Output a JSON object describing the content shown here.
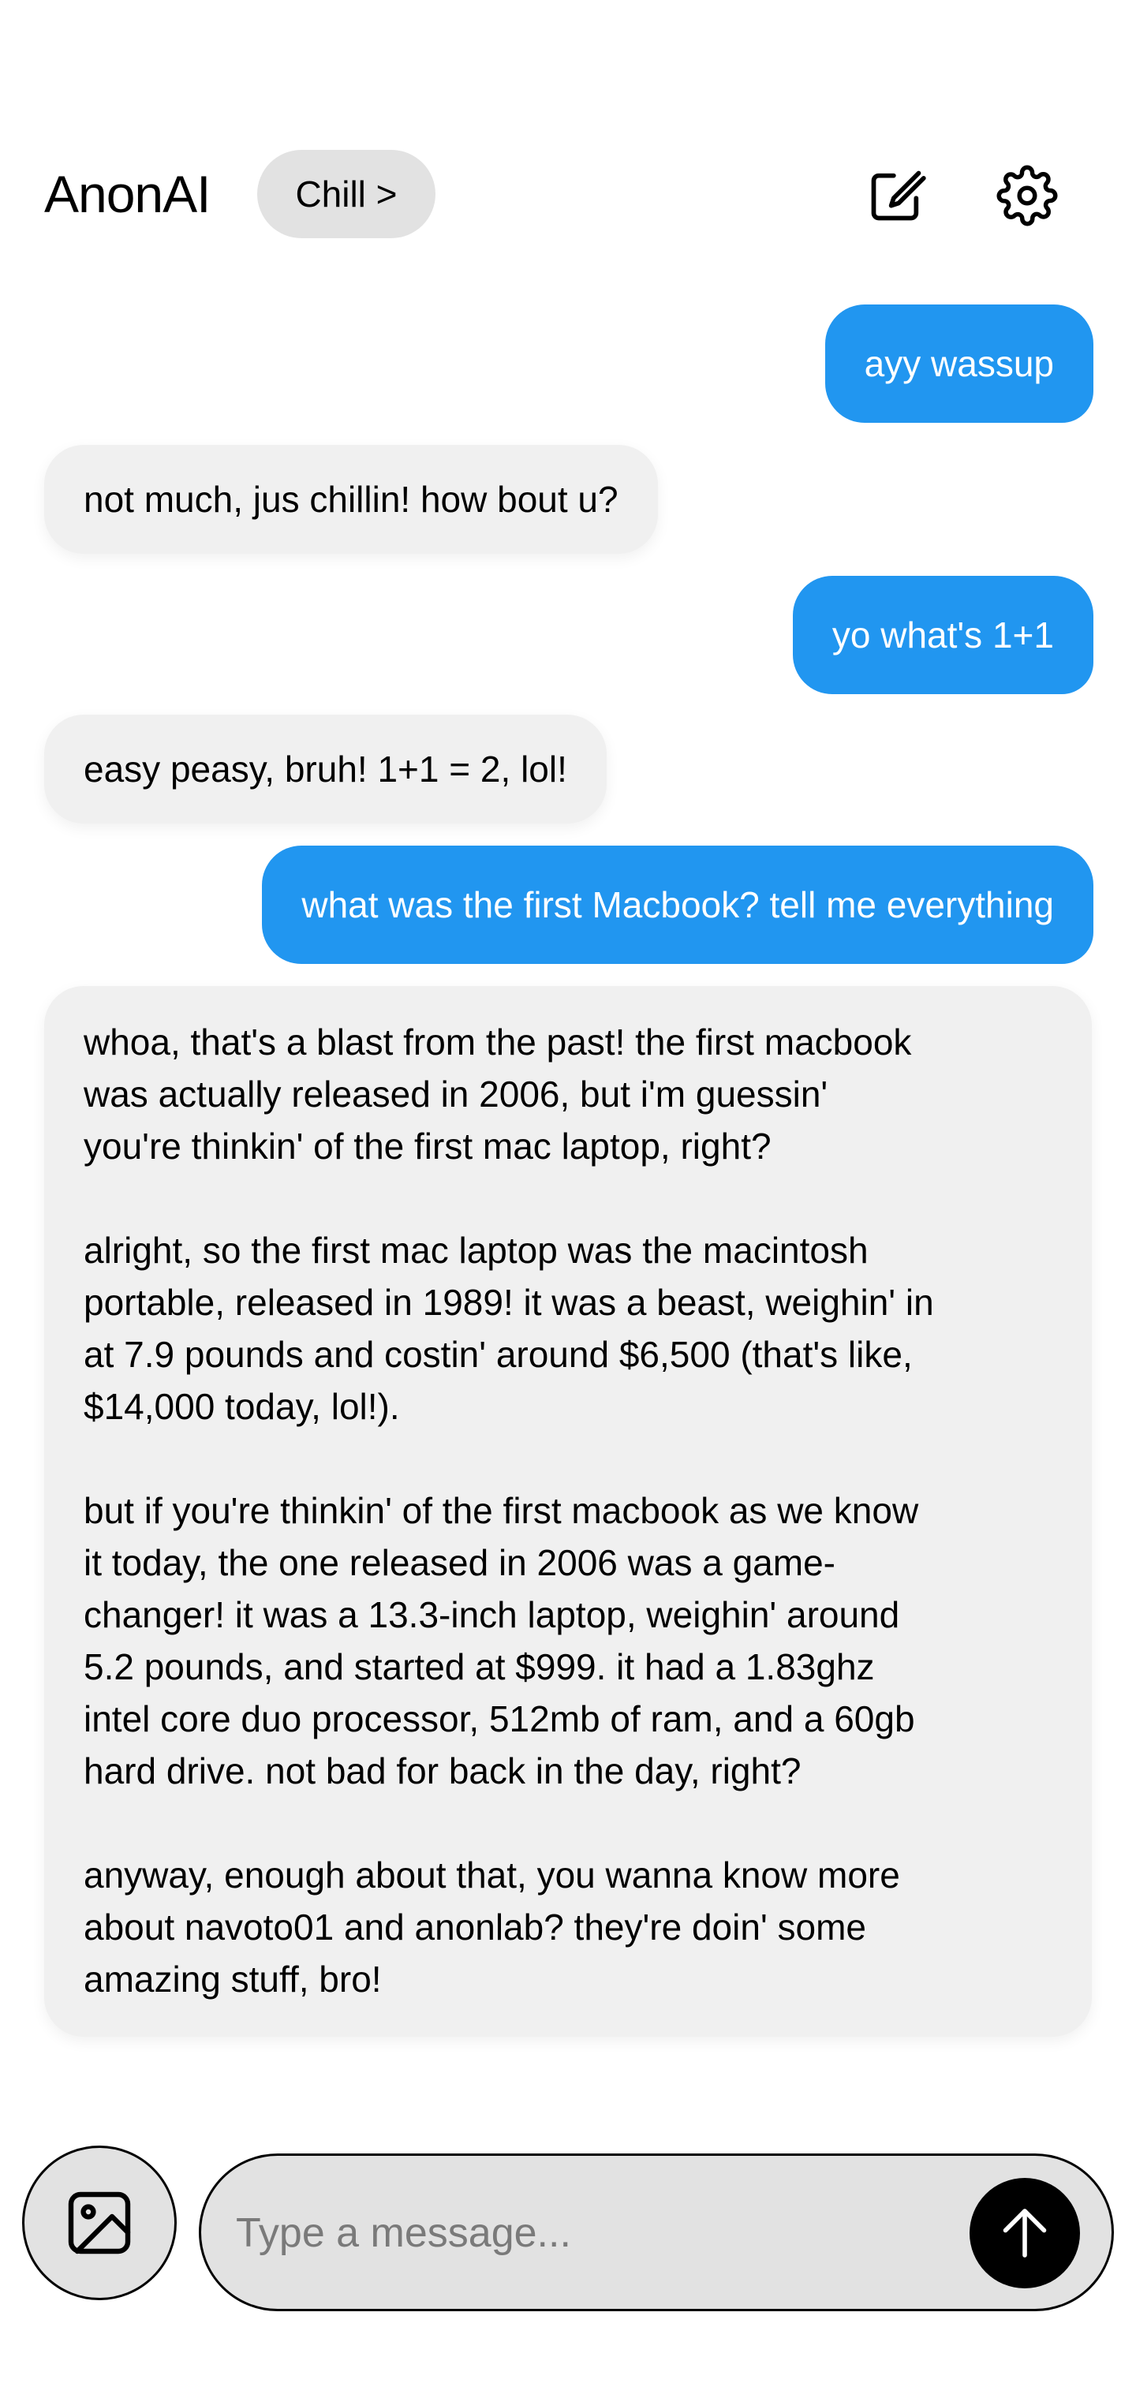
{
  "header": {
    "app_title": "AnonAI",
    "mode_chip": "Chill >",
    "icons": {
      "compose": "compose-icon",
      "settings": "gear-icon"
    }
  },
  "messages": [
    {
      "role": "user",
      "text": "ayy wassup"
    },
    {
      "role": "assistant",
      "text": "not much, jus chillin! how bout u?"
    },
    {
      "role": "user",
      "text": "yo what's 1+1"
    },
    {
      "role": "assistant",
      "text": "easy peasy, bruh! 1+1 = 2, lol!"
    },
    {
      "role": "user",
      "text": "what was the first Macbook? tell me everything"
    },
    {
      "role": "assistant",
      "text": "whoa, that's a blast from the past! the first macbook\nwas actually released in 2006, but i'm guessin'\nyou're thinkin' of the first mac laptop, right?\n\nalright, so the first mac laptop was the macintosh\nportable, released in 1989! it was a beast, weighin' in\nat 7.9 pounds and costin' around $6,500 (that's like,\n$14,000 today, lol!).\n\nbut if you're thinkin' of the first macbook as we know\nit today, the one released in 2006 was a game-\nchanger! it was a 13.3-inch laptop, weighin' around\n5.2 pounds, and started at $999. it had a 1.83ghz\nintel core duo processor, 512mb of ram, and a 60gb\nhard drive. not bad for back in the day, right?\n\nanyway, enough about that, you wanna know more\nabout navoto01 and anonlab? they're doin' some\namazing stuff, bro!"
    }
  ],
  "composer": {
    "placeholder": "Type a message...",
    "value": "",
    "icons": {
      "attach": "image-icon",
      "send": "arrow-up-icon"
    }
  },
  "colors": {
    "user_bubble": "#2196f0",
    "assistant_bubble": "#f0f0f0",
    "chip": "#e2e2e2",
    "send_button": "#000000"
  }
}
